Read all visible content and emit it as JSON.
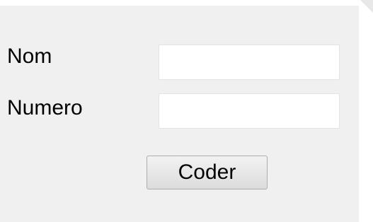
{
  "form": {
    "nom_label": "Nom",
    "nom_value": "",
    "numero_label": "Numero",
    "numero_value": "",
    "submit_label": "Coder"
  },
  "colors": {
    "panel_background": "#f0f0f0",
    "page_background": "#ffffff",
    "input_border": "#e3e3e3",
    "button_border": "#adadad"
  }
}
